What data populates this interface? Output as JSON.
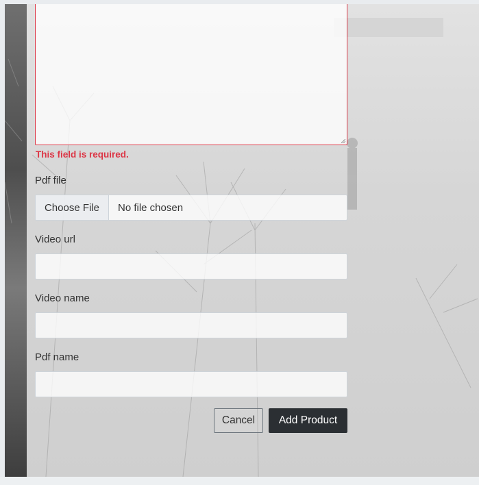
{
  "form": {
    "description_error": "This field is required.",
    "pdf_file": {
      "label": "Pdf file",
      "button_label": "Choose File",
      "status": "No file chosen"
    },
    "video_url": {
      "label": "Video url",
      "value": ""
    },
    "video_name": {
      "label": "Video name",
      "value": ""
    },
    "pdf_name": {
      "label": "Pdf name",
      "value": ""
    },
    "buttons": {
      "cancel": "Cancel",
      "submit": "Add Product"
    }
  },
  "colors": {
    "error": "#dc3545",
    "primary_button": "#2b2f33",
    "input_border": "#ced4da"
  }
}
